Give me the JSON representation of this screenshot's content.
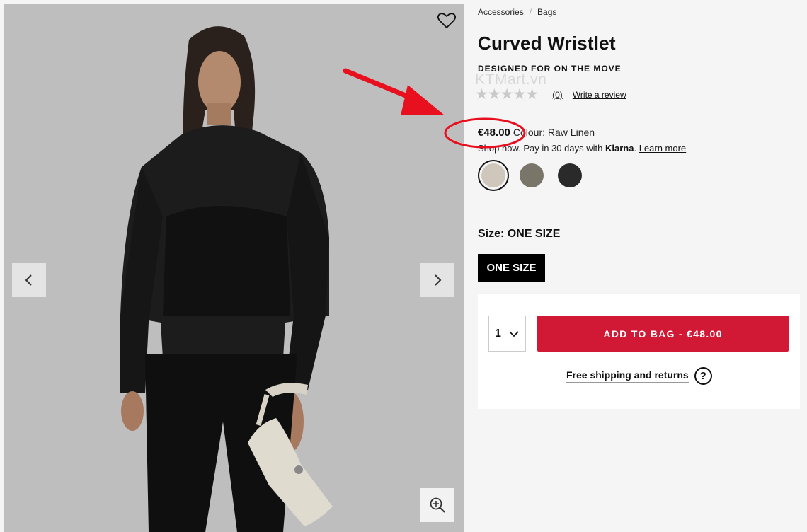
{
  "breadcrumb": {
    "items": [
      "Accessories",
      "Bags"
    ],
    "separator": "/"
  },
  "product": {
    "title": "Curved Wristlet",
    "subtitle": "DESIGNED FOR ON THE MOVE",
    "rating": {
      "stars": "★★★★★",
      "count": "(0)",
      "write_review": "Write a review"
    },
    "price": "€48.00",
    "colour_label": "Colour: Raw Linen",
    "klarna": {
      "prefix": "Shop now. Pay in 30 days with",
      "brand": "Klarna",
      "suffix": ".",
      "link": "Learn more"
    },
    "swatches": [
      {
        "name": "Raw Linen",
        "color": "#cfc6bc",
        "selected": true
      },
      {
        "name": "Olive Grey",
        "color": "#7a7569",
        "selected": false
      },
      {
        "name": "Black",
        "color": "#2a2a2a",
        "selected": false
      }
    ],
    "size_label": "Size: ONE SIZE",
    "size_option": "ONE SIZE"
  },
  "purchase": {
    "quantity": "1",
    "add_to_bag": "ADD TO BAG - €48.00",
    "shipping": "Free shipping and returns",
    "help_glyph": "?"
  },
  "watermark": "KTMart.vn",
  "icons": {
    "favorite": "heart-icon",
    "prev": "chevron-left-icon",
    "next": "chevron-right-icon",
    "zoom": "zoom-in-icon",
    "quantity": "chevron-down-icon"
  },
  "colors": {
    "accent": "#d11936",
    "selected_size_bg": "#000000",
    "annotation": "#e8101e"
  }
}
